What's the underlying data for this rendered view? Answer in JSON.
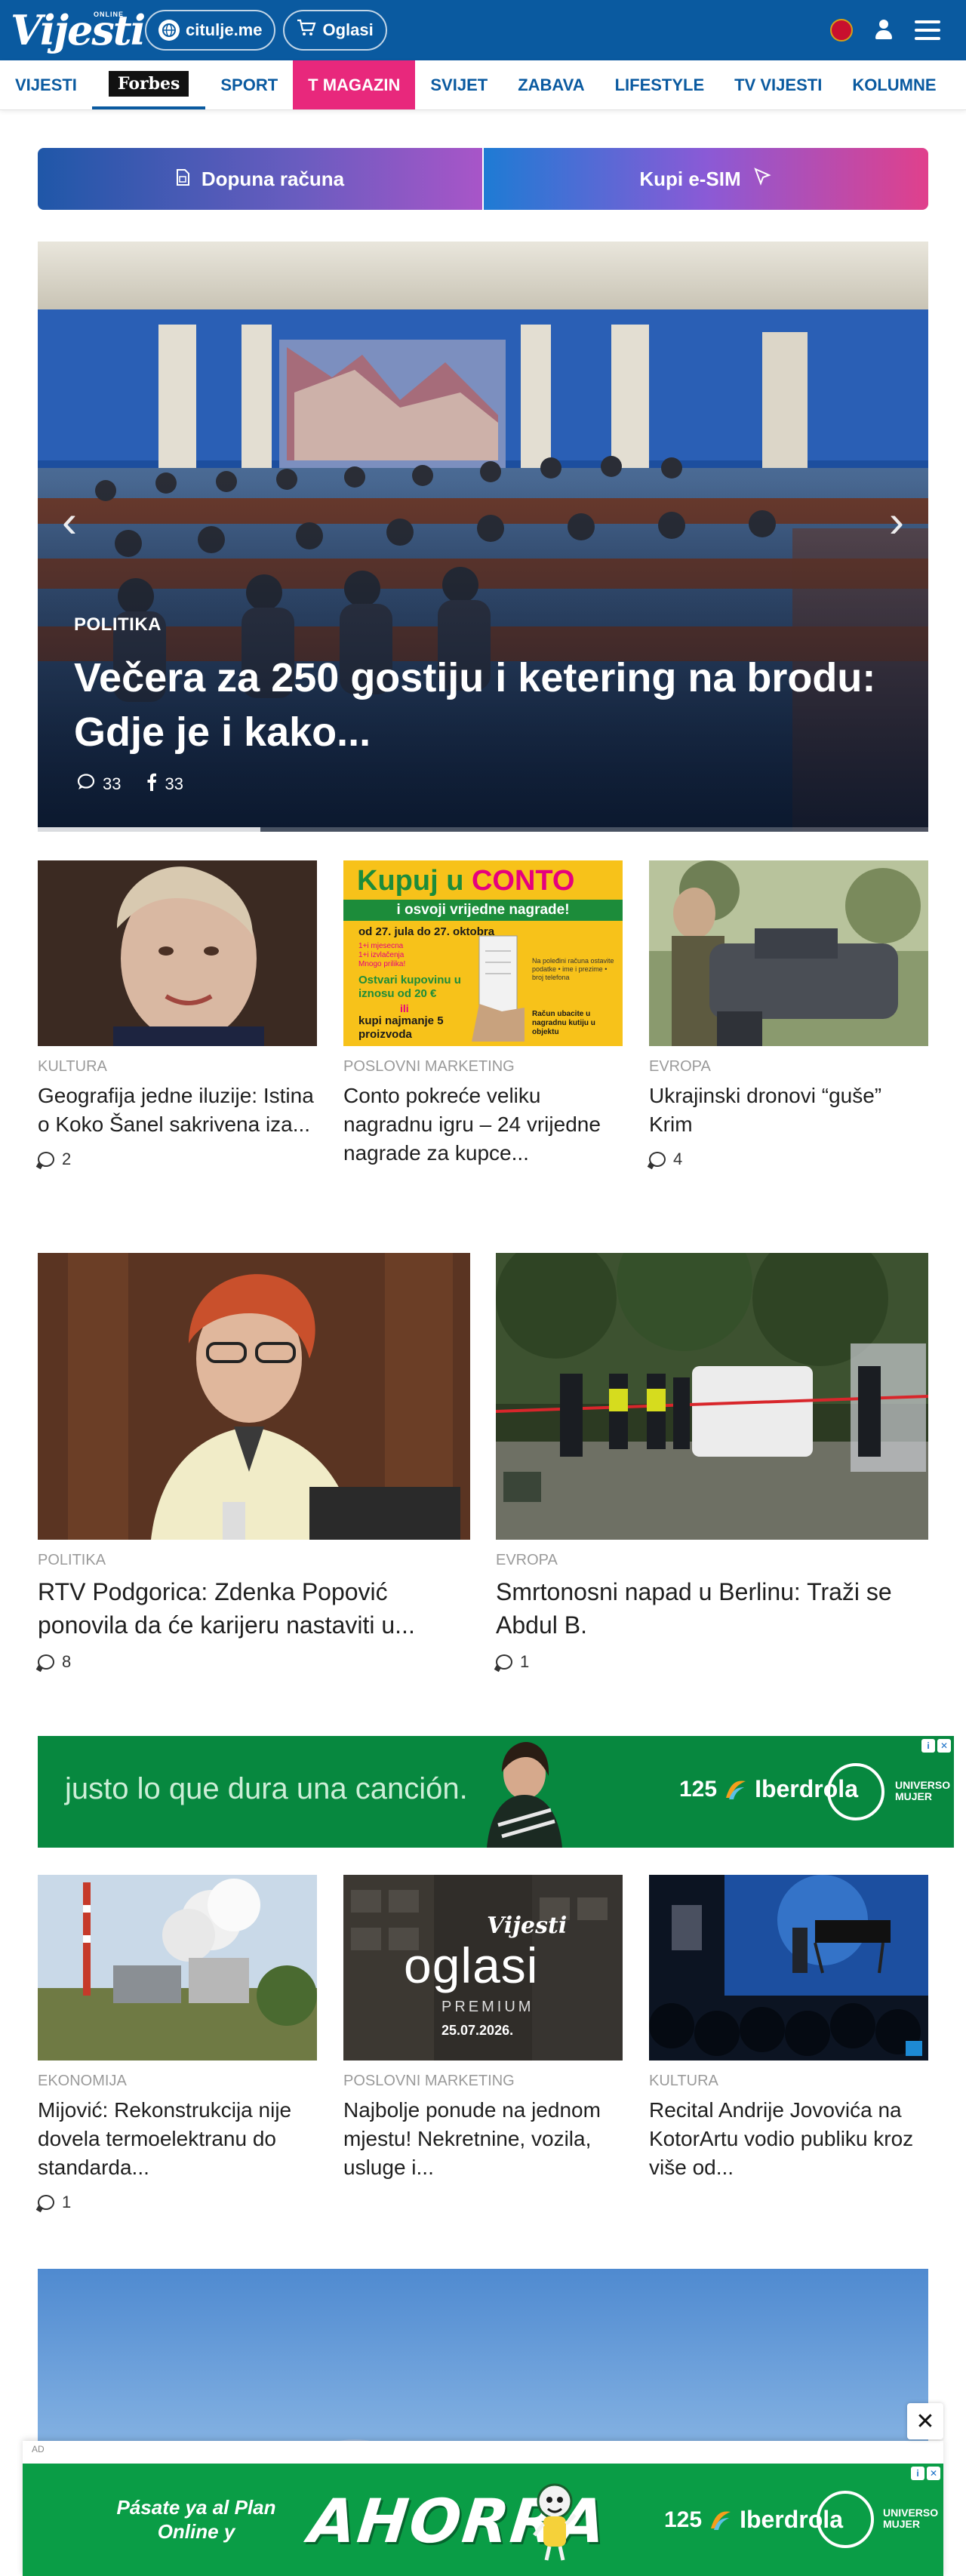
{
  "header": {
    "logo_small": "ONLINE",
    "logo": "Vijesti",
    "pill1": "citulje.me",
    "pill2": "Oglasi"
  },
  "nav": {
    "items": [
      "VIJESTI",
      "Forbes",
      "SPORT",
      "T MAGAZIN",
      "SVIJET",
      "ZABAVA",
      "LIFESTYLE",
      "TV VIJESTI",
      "KOLUMNE"
    ]
  },
  "banner": {
    "left_label": "Dopuna računa",
    "right_label": "Kupi e-SIM"
  },
  "hero": {
    "category": "POLITIKA",
    "title": "Večera za 250 gostiju i ketering na brodu: Gdje je i kako...",
    "comments": "33",
    "shares": "33",
    "progress": 0.25
  },
  "row1": [
    {
      "category": "KULTURA",
      "title": "Geografija jedne iluzije: Istina o Koko Šanel sakrivena iza...",
      "comments": "2"
    },
    {
      "category": "POSLOVNI MARKETING",
      "title": "Conto pokreće veliku nagradnu igru – 24 vrijedne nagrade za kupce...",
      "comments": ""
    },
    {
      "category": "EVROPA",
      "title": "Ukrajinski dronovi “guše” Krim",
      "comments": "4"
    }
  ],
  "conto_ad": {
    "line1": "Kupuj u",
    "brand": "CONTO",
    "line2": "i osvoji vrijedne nagrade!",
    "dates": "od 27. jula do 27. oktobra",
    "small1": "1+i mjesecna",
    "small2": "1+i izvlačenja",
    "small3": "Mnogo prilika!",
    "offer": "Ostvari kupovinu u iznosu od 20 €",
    "or": "ili",
    "buy": "kupi najmanje 5",
    "buy_tail": "proizvoda",
    "note": "Račun ubacite u nagradnu kutiju u objektu",
    "note2": "Na poleđini računa ostavite podatke • ime i prezime • broj telefona"
  },
  "row2": [
    {
      "category": "POLITIKA",
      "title": "RTV Podgorica: Zdenka Popović ponovila da će karijeru nastaviti u...",
      "comments": "8"
    },
    {
      "category": "EVROPA",
      "title": "Smrtonosni napad u Berlinu: Traži se Abdul B.",
      "comments": "1"
    }
  ],
  "ad1": {
    "slogan": "justo lo que dura una canción.",
    "number": "125",
    "brand": "Iberdrola",
    "circle_text": "UNIVERSO MUJER"
  },
  "row3": [
    {
      "category": "EKONOMIJA",
      "title": "Mijović: Rekonstrukcija nije dovela termoelektranu do standarda...",
      "comments": "1"
    },
    {
      "category": "POSLOVNI MARKETING",
      "title": "Najbolje ponude na jednom mjestu! Nekretnine, vozila, usluge i...",
      "comments": ""
    },
    {
      "category": "KULTURA",
      "title": "Recital Andrije Jovovića na KotorArtu vodio publiku kroz više od...",
      "comments": ""
    }
  ],
  "oglasi_ad": {
    "brand": "Vijesti",
    "word": "oglasi",
    "tier": "PREMIUM",
    "date": "25.07.2026."
  },
  "sticky_ad": {
    "label": "AD",
    "close": "✕",
    "pasate": "Pásate ya al Plan Online y",
    "ahorra": "AHORRA",
    "number": "125",
    "brand": "Iberdrola",
    "circle_text": "UNIVERSO MUJER"
  },
  "colors": {
    "brand_blue": "#0a5aa0",
    "tmagazin_pink": "#e8287c",
    "ad_green": "#07883f",
    "conto_yellow": "#f7c21a"
  }
}
